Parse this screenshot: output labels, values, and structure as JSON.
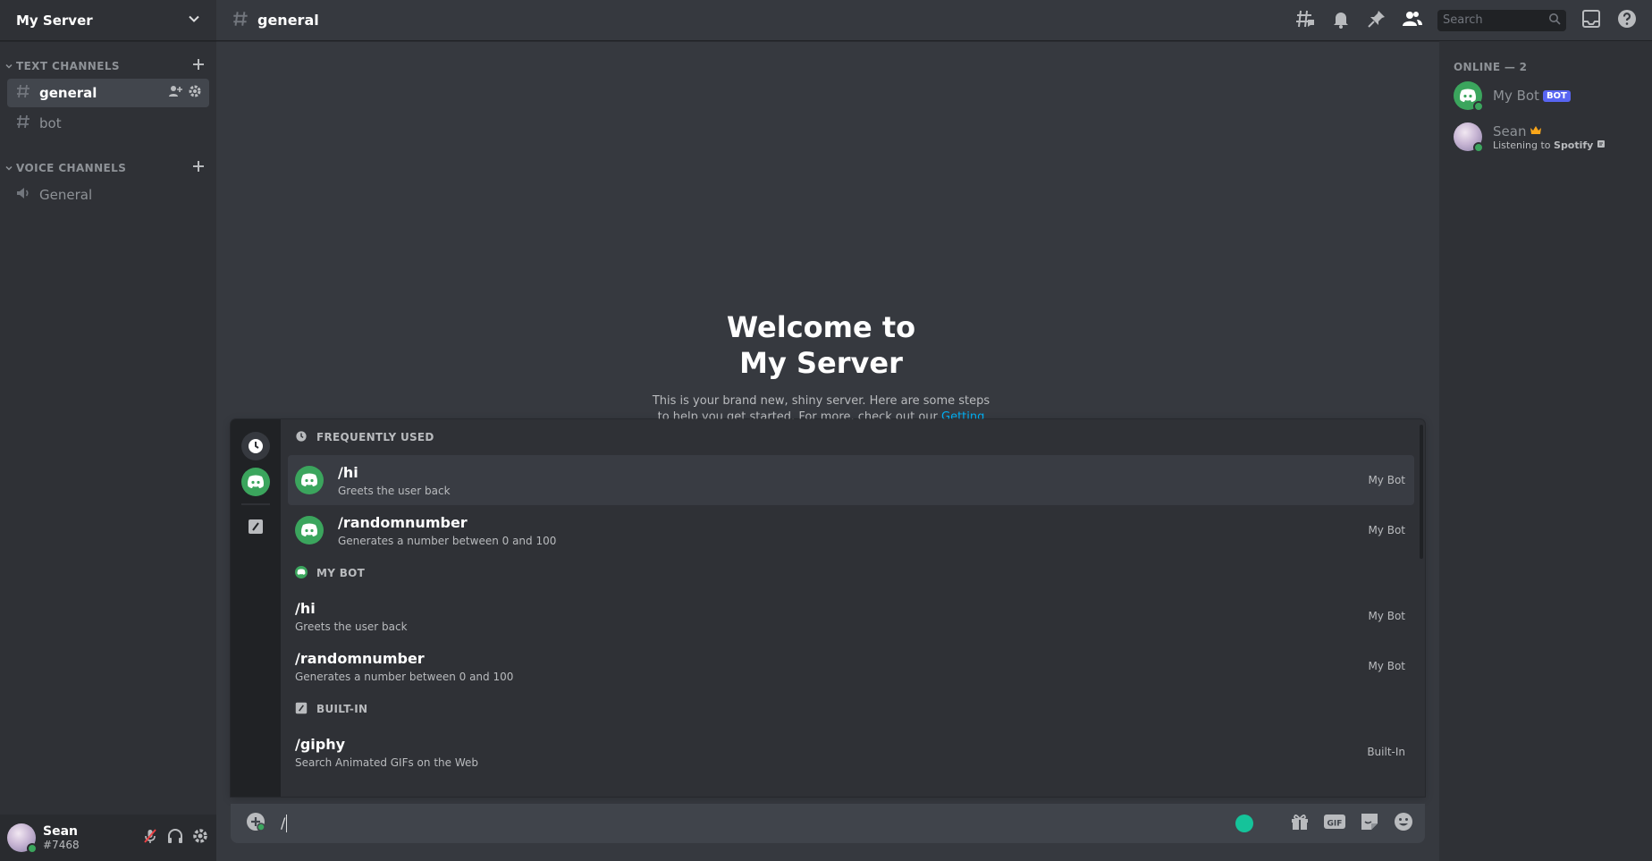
{
  "server": {
    "name": "My Server"
  },
  "sidebar": {
    "categories": [
      {
        "label": "TEXT CHANNELS",
        "channels": [
          {
            "name": "general",
            "type": "text",
            "active": true
          },
          {
            "name": "bot",
            "type": "text",
            "active": false
          }
        ]
      },
      {
        "label": "VOICE CHANNELS",
        "channels": [
          {
            "name": "General",
            "type": "voice",
            "active": false
          }
        ]
      }
    ]
  },
  "topbar": {
    "channel_name": "general",
    "search_placeholder": "Search"
  },
  "welcome": {
    "title_line1": "Welcome to",
    "title_line2": "My Server",
    "desc_pre": "This is your brand new, shiny server. Here are some steps to help you get started. For more, check out our ",
    "desc_link": "Getting Started guide",
    "desc_post": "."
  },
  "popup": {
    "sections": [
      {
        "label": "FREQUENTLY USED",
        "icon": "clock-icon",
        "show_app_icon": true,
        "commands": [
          {
            "name": "/hi",
            "desc": "Greets the user back",
            "source": "My Bot",
            "selected": true
          },
          {
            "name": "/randomnumber",
            "desc": "Generates a number between 0 and 100",
            "source": "My Bot",
            "selected": false
          }
        ]
      },
      {
        "label": "MY BOT",
        "icon": "discord-icon",
        "show_app_icon": false,
        "commands": [
          {
            "name": "/hi",
            "desc": "Greets the user back",
            "source": "My Bot",
            "selected": false
          },
          {
            "name": "/randomnumber",
            "desc": "Generates a number between 0 and 100",
            "source": "My Bot",
            "selected": false
          }
        ]
      },
      {
        "label": "BUILT-IN",
        "icon": "slash-box-icon",
        "show_app_icon": false,
        "commands": [
          {
            "name": "/giphy",
            "desc": "Search Animated GIFs on the Web",
            "source": "Built-In",
            "selected": false
          }
        ]
      }
    ]
  },
  "composer": {
    "value": "/"
  },
  "members": {
    "header": "ONLINE — 2",
    "list": [
      {
        "name": "My Bot",
        "badge": "BOT",
        "activity": "",
        "activity_app": ""
      },
      {
        "name": "Sean",
        "badge": "",
        "activity": "Listening to ",
        "activity_app": "Spotify"
      }
    ]
  },
  "user": {
    "name": "Sean",
    "tag": "#7468"
  },
  "colors": {
    "background": "#36393f",
    "sidebar": "#2f3136",
    "accent_green": "#3ba55d",
    "blurple": "#5865f2",
    "link": "#00b0f4"
  }
}
